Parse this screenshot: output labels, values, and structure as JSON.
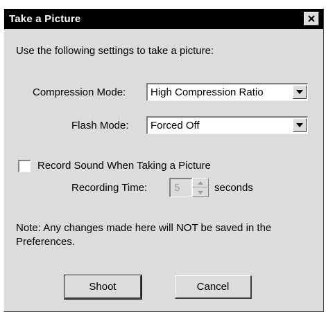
{
  "window": {
    "title": "Take a Picture"
  },
  "intro": "Use the following settings to take a picture:",
  "compression": {
    "label": "Compression Mode:",
    "value": "High Compression Ratio"
  },
  "flash": {
    "label": "Flash Mode:",
    "value": "Forced Off"
  },
  "record_sound": {
    "label": "Record Sound When Taking a Picture",
    "checked": false
  },
  "recording_time": {
    "label": "Recording Time:",
    "value": "5",
    "unit": "seconds",
    "enabled": false
  },
  "note": {
    "line1": "Note: Any changes made here will NOT be saved in the",
    "line2": "Preferences."
  },
  "buttons": {
    "shoot": "Shoot",
    "cancel": "Cancel"
  },
  "icons": {
    "close": "close-icon",
    "dropdown": "chevron-down-icon",
    "spin_up": "arrow-up-icon",
    "spin_down": "arrow-down-icon"
  }
}
